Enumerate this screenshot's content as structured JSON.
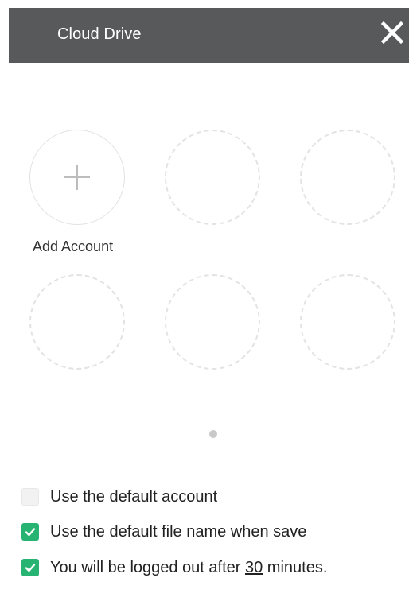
{
  "header": {
    "title": "Cloud Drive",
    "close_icon": "close-icon",
    "background": "#58595b"
  },
  "accounts": {
    "add_label": "Add Account",
    "add_icon": "plus-icon",
    "empty_slots": 5,
    "page_indicator": {
      "pages": 1,
      "current": 1
    }
  },
  "options": {
    "default_account": {
      "label": "Use the default account",
      "checked": false
    },
    "default_filename": {
      "label": "Use the default file name when save",
      "checked": true
    },
    "logout": {
      "prefix": "You will be logged out after ",
      "minutes": "30",
      "suffix": " minutes.",
      "checked": true
    }
  },
  "colors": {
    "accent": "#27b473",
    "checkbox_off": "#f2f2f2"
  }
}
